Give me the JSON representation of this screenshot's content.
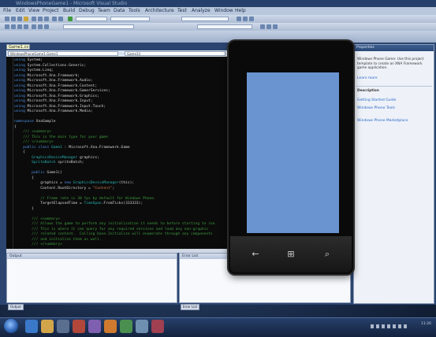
{
  "window": {
    "title": "WindowsPhoneGame1 - Microsoft Visual Studio",
    "menus": [
      "File",
      "Edit",
      "View",
      "Project",
      "Build",
      "Debug",
      "Team",
      "Data",
      "Tools",
      "Architecture",
      "Test",
      "Analyze",
      "Window",
      "Help"
    ]
  },
  "editor": {
    "doc_tab": "Game1.cs",
    "nav_left": "WindowsPhoneGame1.Game1",
    "nav_right": "Game1()",
    "lines": [
      [
        [
          "k",
          "using "
        ],
        [
          "t",
          "System;"
        ]
      ],
      [
        [
          "k",
          "using "
        ],
        [
          "t",
          "System.Collections.Generic;"
        ]
      ],
      [
        [
          "k",
          "using "
        ],
        [
          "t",
          "System.Linq;"
        ]
      ],
      [
        [
          "k",
          "using "
        ],
        [
          "t",
          "Microsoft.Xna.Framework;"
        ]
      ],
      [
        [
          "k",
          "using "
        ],
        [
          "t",
          "Microsoft.Xna.Framework.Audio;"
        ]
      ],
      [
        [
          "k",
          "using "
        ],
        [
          "t",
          "Microsoft.Xna.Framework.Content;"
        ]
      ],
      [
        [
          "k",
          "using "
        ],
        [
          "t",
          "Microsoft.Xna.Framework.GamerServices;"
        ]
      ],
      [
        [
          "k",
          "using "
        ],
        [
          "t",
          "Microsoft.Xna.Framework.Graphics;"
        ]
      ],
      [
        [
          "k",
          "using "
        ],
        [
          "t",
          "Microsoft.Xna.Framework.Input;"
        ]
      ],
      [
        [
          "k",
          "using "
        ],
        [
          "t",
          "Microsoft.Xna.Framework.Input.Touch;"
        ]
      ],
      [
        [
          "k",
          "using "
        ],
        [
          "t",
          "Microsoft.Xna.Framework.Media;"
        ]
      ],
      [
        [
          "t",
          ""
        ]
      ],
      [
        [
          "k",
          "namespace "
        ],
        [
          "t",
          "XnaSample"
        ]
      ],
      [
        [
          "t",
          "{"
        ]
      ],
      [
        [
          "c",
          "    /// <summary>"
        ]
      ],
      [
        [
          "c",
          "    /// This is the main type for your game"
        ]
      ],
      [
        [
          "c",
          "    /// </summary>"
        ]
      ],
      [
        [
          "k",
          "    public class "
        ],
        [
          "ty",
          "Game1 "
        ],
        [
          "t",
          ": Microsoft.Xna.Framework.Game"
        ]
      ],
      [
        [
          "t",
          "    {"
        ]
      ],
      [
        [
          "ty",
          "        GraphicsDeviceManager "
        ],
        [
          "t",
          "graphics;"
        ]
      ],
      [
        [
          "ty",
          "        SpriteBatch "
        ],
        [
          "t",
          "spriteBatch;"
        ]
      ],
      [
        [
          "t",
          ""
        ]
      ],
      [
        [
          "k",
          "        public "
        ],
        [
          "t",
          "Game1()"
        ]
      ],
      [
        [
          "t",
          "        {"
        ]
      ],
      [
        [
          "t",
          "            graphics = "
        ],
        [
          "k",
          "new "
        ],
        [
          "ty",
          "GraphicsDeviceManager"
        ],
        [
          "t",
          "(this);"
        ]
      ],
      [
        [
          "t",
          "            Content.RootDirectory = "
        ],
        [
          "s",
          "\"Content\""
        ],
        [
          "t",
          ";"
        ]
      ],
      [
        [
          "t",
          ""
        ]
      ],
      [
        [
          "c",
          "            // Frame rate is 30 fps by default for Windows Phone."
        ]
      ],
      [
        [
          "t",
          "            TargetElapsedTime = "
        ],
        [
          "ty",
          "TimeSpan"
        ],
        [
          "t",
          ".FromTicks(333333);"
        ]
      ],
      [
        [
          "t",
          "        }"
        ]
      ],
      [
        [
          "t",
          ""
        ]
      ],
      [
        [
          "c",
          "        /// <summary>"
        ]
      ],
      [
        [
          "c",
          "        /// Allows the game to perform any initialization it needs to before starting to run."
        ]
      ],
      [
        [
          "c",
          "        /// This is where it can query for any required services and load any non-graphic"
        ]
      ],
      [
        [
          "c",
          "        /// related content.  Calling base.Initialize will enumerate through any components"
        ]
      ],
      [
        [
          "c",
          "        /// and initialize them as well."
        ]
      ],
      [
        [
          "c",
          "        /// </summary>"
        ]
      ]
    ]
  },
  "panes": {
    "left_title": "Output",
    "left_tab": "Output",
    "right_title": "Error List",
    "right_tab": "Error List"
  },
  "solution_panel": {
    "title": "Properties",
    "description": "Windows Phone Game: Use this project template to create an XNA Framework game application.",
    "link1": "Learn more",
    "section": "Description",
    "items": [
      "Getting Started Guide",
      "Windows Phone Tools",
      "Windows Phone Marketplace"
    ]
  },
  "phone": {
    "back_icon": "←",
    "start_icon": "⊞",
    "search_icon": "⌕",
    "screen_color": "#6a94cf"
  },
  "taskbar": {
    "clock": "11:26"
  }
}
